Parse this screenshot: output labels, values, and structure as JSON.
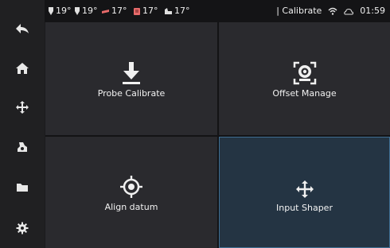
{
  "sidebar": {
    "items": [
      {
        "icon": "back-arrow-icon"
      },
      {
        "icon": "home-icon"
      },
      {
        "icon": "move-icon"
      },
      {
        "icon": "extrude-icon"
      },
      {
        "icon": "folder-icon"
      },
      {
        "icon": "settings-icon"
      }
    ]
  },
  "status": {
    "temps": [
      {
        "icon": "extruder-icon",
        "value": "19°"
      },
      {
        "icon": "extruder-icon",
        "value": "19°"
      },
      {
        "icon": "heated-bed-icon",
        "value": "17°"
      },
      {
        "icon": "chamber-icon",
        "value": "17°"
      },
      {
        "icon": "mcu-icon",
        "value": "17°"
      }
    ],
    "page_title": "| Calibrate",
    "time": "01:59"
  },
  "menu": {
    "tiles": [
      {
        "label": "Probe Calibrate",
        "icon": "probe-down-arrow-icon"
      },
      {
        "label": "Offset Manage",
        "icon": "offset-camera-icon"
      },
      {
        "label": "Align datum",
        "icon": "crosshair-target-icon"
      },
      {
        "label": "Input Shaper",
        "icon": "move-arrows-icon"
      }
    ]
  },
  "colors": {
    "background": "#1b1b1d",
    "tile": "#2a2a2e",
    "selected_tile": "#243443",
    "selected_border": "#3f6e92"
  }
}
